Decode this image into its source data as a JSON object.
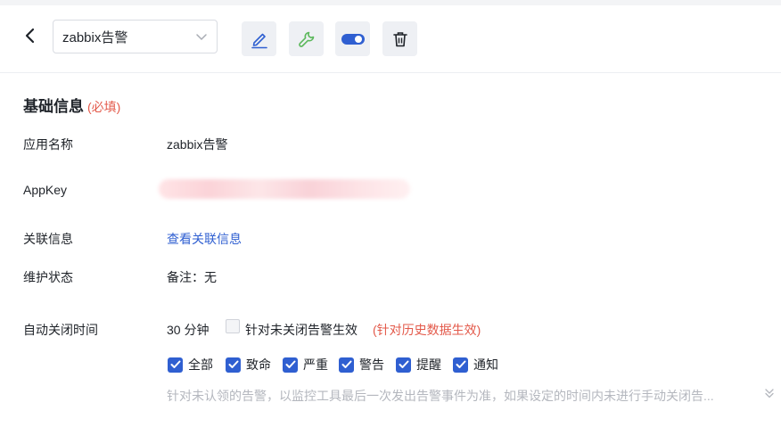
{
  "header": {
    "app_select_value": "zabbix告警"
  },
  "section": {
    "title": "基础信息",
    "required_note": "(必填)"
  },
  "fields": {
    "app_name_label": "应用名称",
    "app_name_value": "zabbix告警",
    "appkey_label": "AppKey",
    "related_label": "关联信息",
    "related_link": "查看关联信息",
    "maintenance_label": "维护状态",
    "maintenance_value": "备注：无",
    "auto_close_label": "自动关闭时间",
    "auto_close_value": "30 分钟",
    "unclosed_checkbox_label": "针对未关闭告警生效",
    "history_note": "(针对历史数据生效)"
  },
  "severity_checkboxes": [
    {
      "label": "全部",
      "checked": true
    },
    {
      "label": "致命",
      "checked": true
    },
    {
      "label": "严重",
      "checked": true
    },
    {
      "label": "警告",
      "checked": true
    },
    {
      "label": "提醒",
      "checked": true
    },
    {
      "label": "通知",
      "checked": true
    }
  ],
  "hint_text": "针对未认领的告警，以监控工具最后一次发出告警事件为准，如果设定的时间内未进行手动关闭告...",
  "colors": {
    "accent": "#2f5fd1",
    "required": "#e3594a",
    "wrench": "#5cb85c"
  },
  "icons": [
    "back-arrow-icon",
    "chevron-down-icon",
    "edit-pen-icon",
    "wrench-icon",
    "toggle-icon",
    "trash-icon",
    "double-chevron-down-icon"
  ]
}
